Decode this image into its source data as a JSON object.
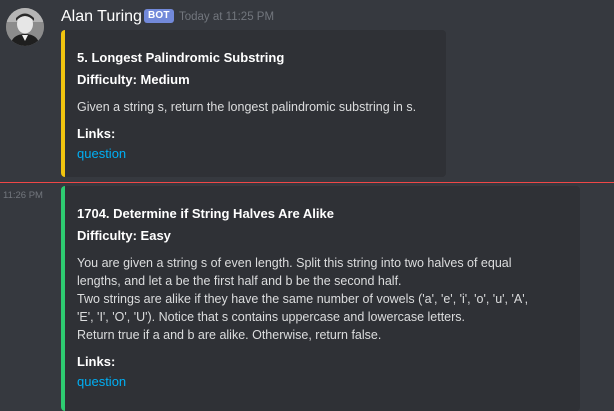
{
  "message_header": {
    "username": "Alan Turing",
    "badge": "BOT",
    "timestamp": "Today at 11:25 PM"
  },
  "embed1": {
    "accent_color": "#f1c40f",
    "title": "5. Longest Palindromic Substring",
    "difficulty": "Difficulty: Medium",
    "description": "Given a string s, return the longest palindromic substring in s.",
    "links_label": "Links:",
    "link_text": "question"
  },
  "new_messages_divider_color": "#f04747",
  "message2": {
    "timestamp": "11:26 PM"
  },
  "embed2": {
    "accent_color": "#2ecc71",
    "title": "1704. Determine if String Halves Are Alike",
    "difficulty": "Difficulty: Easy",
    "description": "You are given a string s of even length. Split this string into two halves of equal\nlengths, and let a be the first half and b be the second half.\nTwo strings are alike if they have the same number of vowels ('a', 'e', 'i', 'o', 'u', 'A',\n'E', 'I', 'O', 'U'). Notice that s contains uppercase and lowercase letters.\nReturn true if a and b are alike. Otherwise, return false.",
    "links_label": "Links:",
    "link_text": "question"
  }
}
